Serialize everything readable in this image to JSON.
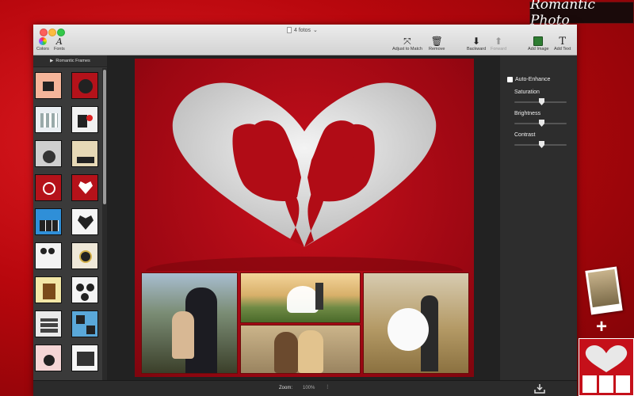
{
  "brand": "Romantic Photo",
  "window": {
    "document_title": "4 fotos",
    "toolbar": {
      "colors": "Colors",
      "fonts": "Fonts",
      "adjust": "Adjust to Match",
      "remove": "Remove",
      "backward": "Backward",
      "forward": "Forward",
      "add_image": "Add Image",
      "add_text": "Add Text"
    }
  },
  "sidebar": {
    "title": "Romantic Frames"
  },
  "panel": {
    "auto_enhance": "Auto-Enhance",
    "saturation": "Saturation",
    "brightness": "Brightness",
    "contrast": "Contrast"
  },
  "bottom": {
    "zoom_label": "Zoom:",
    "zoom_value": "100%"
  },
  "icons": {
    "plus": "+",
    "export": "export-icon"
  },
  "colors": {
    "accent": "#c9101c",
    "dark": "#2b2b2b"
  }
}
